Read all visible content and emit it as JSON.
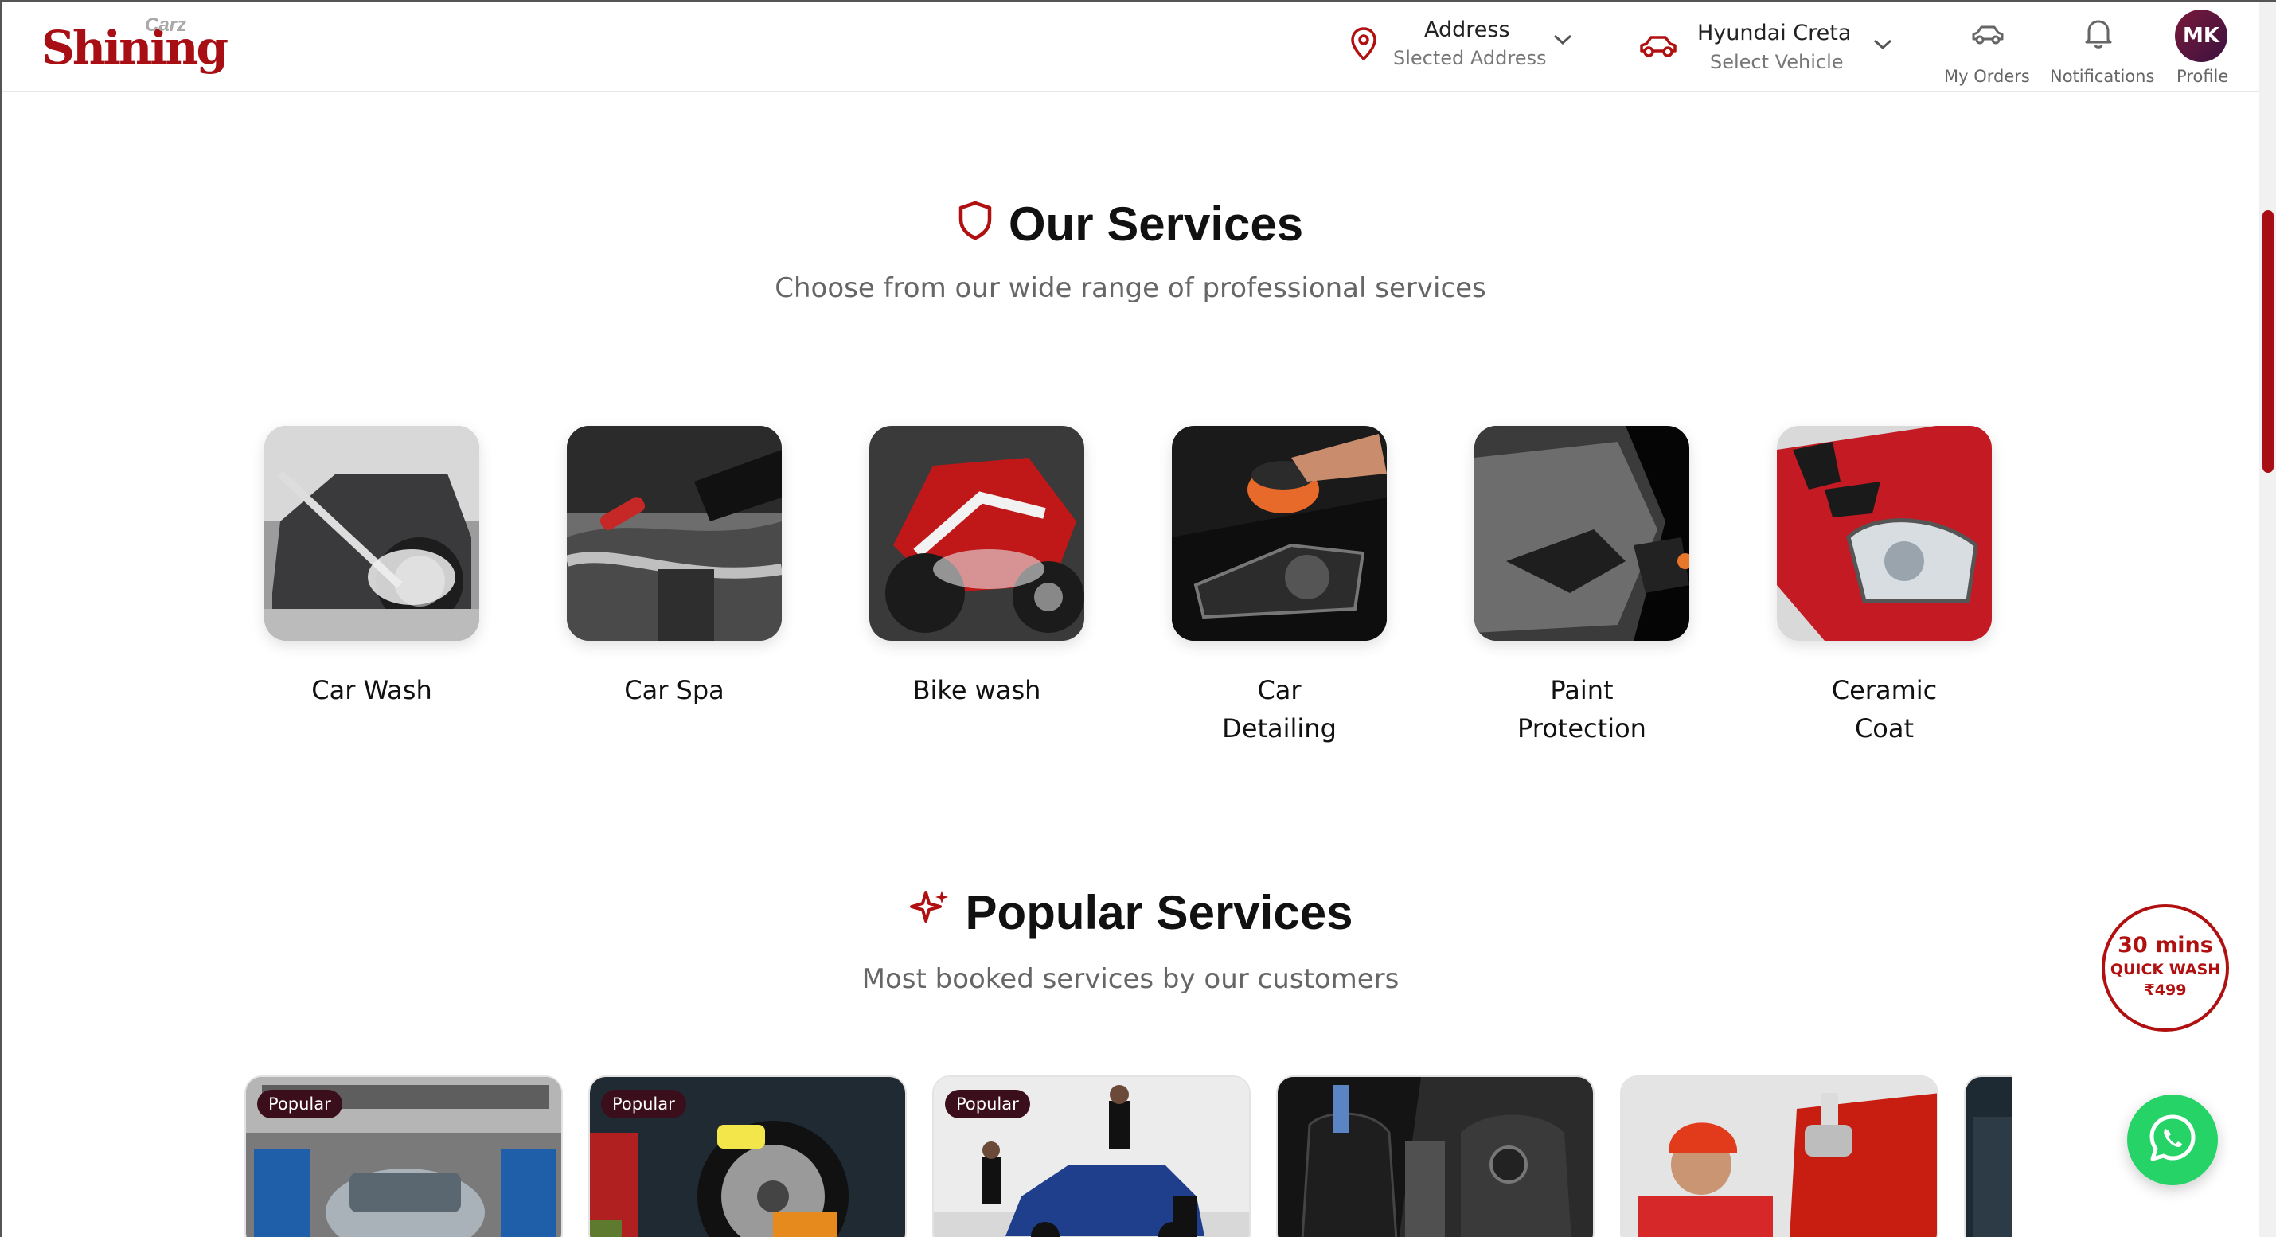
{
  "brand": {
    "name": "Shining",
    "sub": "Carz",
    "color": "#a80f14"
  },
  "header": {
    "address": {
      "title": "Address",
      "subtitle": "Slected Address",
      "icon": "map-pin-icon"
    },
    "vehicle": {
      "title": "Hyundai Creta",
      "subtitle": "Select Vehicle",
      "icon": "car-icon"
    },
    "orders_label": "My Orders",
    "notifications_label": "Notifications",
    "profile_label": "Profile",
    "avatar_initials": "MK"
  },
  "our_services": {
    "title": "Our Services",
    "subtitle": "Choose from our wide range of professional services",
    "icon": "shield-icon",
    "items": [
      {
        "label": "Car Wash"
      },
      {
        "label": "Car Spa"
      },
      {
        "label": "Bike wash"
      },
      {
        "label": "Car Detailing"
      },
      {
        "label": "Paint Protection"
      },
      {
        "label": "Ceramic Coat"
      }
    ]
  },
  "popular_services": {
    "title": "Popular Services",
    "subtitle": "Most booked services by our customers",
    "icon": "sparkle-icon",
    "cards": [
      {
        "badge": "Popular"
      },
      {
        "badge": "Popular"
      },
      {
        "badge": "Popular"
      },
      {
        "badge": ""
      },
      {
        "badge": ""
      }
    ]
  },
  "quick_wash": {
    "line1": "30 mins",
    "line2": "QUICK WASH",
    "line3": "₹499"
  },
  "whatsapp": {
    "icon": "whatsapp-icon",
    "color": "#25d366"
  }
}
